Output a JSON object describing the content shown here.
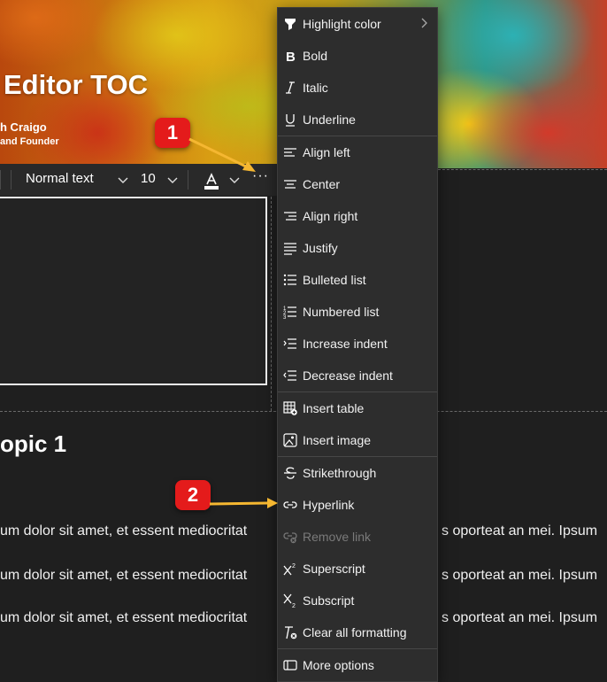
{
  "header": {
    "title": "Editor TOC",
    "author_name": "h Craigo",
    "author_role": "and Founder"
  },
  "toolbar": {
    "style_value": "Normal text",
    "size_value": "10",
    "more_label": "···"
  },
  "content": {
    "heading": "opic 1",
    "paragraphs": [
      {
        "left": "um dolor sit amet, et essent mediocritat",
        "right": "s oporteat an mei. Ipsum"
      },
      {
        "left": "um dolor sit amet, et essent mediocritat",
        "right": "s oporteat an mei. Ipsum"
      },
      {
        "left": "um dolor sit amet, et essent mediocritat",
        "right": "s oporteat an mei. Ipsum"
      }
    ]
  },
  "menu": {
    "items": [
      {
        "label": "Highlight color",
        "icon": "highlighter-icon",
        "enabled": true
      },
      {
        "label": "Bold",
        "icon": "bold-icon",
        "enabled": true
      },
      {
        "label": "Italic",
        "icon": "italic-icon",
        "enabled": true
      },
      {
        "label": "Underline",
        "icon": "underline-icon",
        "enabled": true
      },
      {
        "label": "Align left",
        "icon": "align-left-icon",
        "enabled": true
      },
      {
        "label": "Center",
        "icon": "align-center-icon",
        "enabled": true
      },
      {
        "label": "Align right",
        "icon": "align-right-icon",
        "enabled": true
      },
      {
        "label": "Justify",
        "icon": "justify-icon",
        "enabled": true
      },
      {
        "label": "Bulleted list",
        "icon": "bulleted-list-icon",
        "enabled": true
      },
      {
        "label": "Numbered list",
        "icon": "numbered-list-icon",
        "enabled": true
      },
      {
        "label": "Increase indent",
        "icon": "increase-indent-icon",
        "enabled": true
      },
      {
        "label": "Decrease indent",
        "icon": "decrease-indent-icon",
        "enabled": true
      },
      {
        "label": "Insert table",
        "icon": "insert-table-icon",
        "enabled": true
      },
      {
        "label": "Insert image",
        "icon": "insert-image-icon",
        "enabled": true
      },
      {
        "label": "Strikethrough",
        "icon": "strikethrough-icon",
        "enabled": true
      },
      {
        "label": "Hyperlink",
        "icon": "link-icon",
        "enabled": true
      },
      {
        "label": "Remove link",
        "icon": "remove-link-icon",
        "enabled": false
      },
      {
        "label": "Superscript",
        "icon": "superscript-icon",
        "enabled": true
      },
      {
        "label": "Subscript",
        "icon": "subscript-icon",
        "enabled": true
      },
      {
        "label": "Clear all formatting",
        "icon": "clear-formatting-icon",
        "enabled": true
      },
      {
        "label": "More options",
        "icon": "more-options-icon",
        "enabled": true
      }
    ]
  },
  "callouts": {
    "one": "1",
    "two": "2"
  },
  "colors": {
    "badge": "#e41b1b",
    "arrow": "#f5b731",
    "menu_bg": "#2d2d2d"
  }
}
